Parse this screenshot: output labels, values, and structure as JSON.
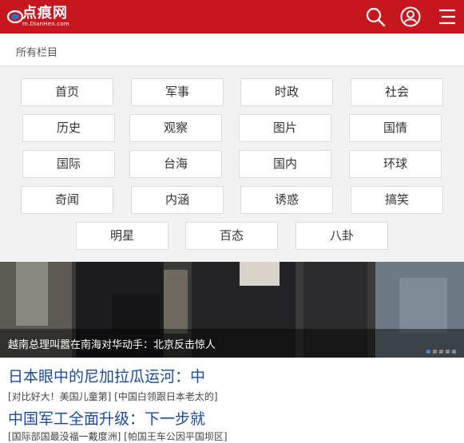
{
  "header": {
    "logo_text": "点痕网",
    "logo_sub": "m.DianHen.com",
    "icons": [
      "search-icon",
      "user-icon",
      "menu-icon"
    ],
    "colors": {
      "header_bg": "#c8161d"
    }
  },
  "section": {
    "label": "所有栏目"
  },
  "categories": [
    "首页",
    "军事",
    "时政",
    "社会",
    "历史",
    "观察",
    "图片",
    "国情",
    "国际",
    "台海",
    "国内",
    "环球",
    "奇闻",
    "内涵",
    "诱惑",
    "搞笑",
    "明星",
    "百态",
    "八卦"
  ],
  "hero": {
    "caption": "越南总理叫嚣在南海对华动手：北京反击惊人"
  },
  "news": [
    {
      "headline": "日本眼中的尼加拉瓜运河：中",
      "links": "[对比好大！美国儿童第] [中国白领跟日本老太的]"
    },
    {
      "headline": "中国军工全面升级：下一步就",
      "links": "[国际部国最没福一戴度洲] [帕国王车公因平国坝区]"
    }
  ]
}
